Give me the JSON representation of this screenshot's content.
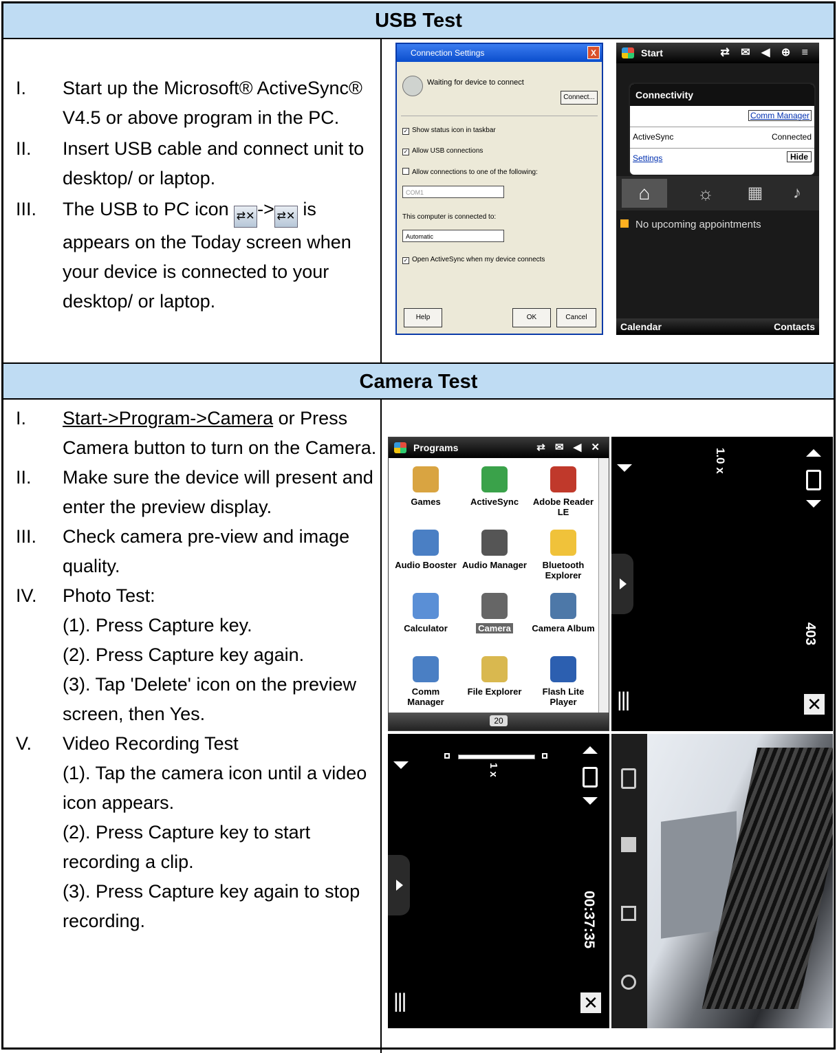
{
  "usb": {
    "heading": "USB Test",
    "steps": [
      {
        "num": "I.",
        "lines": [
          "Start up the Microsoft® ActiveSync® V4.5 or above program in the PC."
        ]
      },
      {
        "num": "II.",
        "lines": [
          "Insert USB cable and connect unit to desktop/ or laptop."
        ]
      },
      {
        "num": "III.",
        "pre": "The USB to PC icon",
        "mid": "->",
        "post": "is appears on the Today screen when your device is connected to your desktop/ or laptop."
      }
    ],
    "dialog": {
      "title": "Connection Settings",
      "close": "X",
      "status": "Waiting for device to connect",
      "connect_btn": "Connect...",
      "options": [
        "Show status icon in taskbar",
        "Allow USB connections",
        "Allow connections to one of the following:"
      ],
      "com_value": "COM1",
      "connected_to_label": "This computer is connected to:",
      "connected_to_value": "Automatic",
      "open_option": "Open ActiveSync when my device connects",
      "help_btn": "Help",
      "ok_btn": "OK",
      "cancel_btn": "Cancel"
    },
    "phone": {
      "start": "Start",
      "popup_title": "Connectivity",
      "comm_manager": "Comm Manager",
      "activesync": "ActiveSync",
      "activesync_status": "Connected",
      "settings": "Settings",
      "hide": "Hide",
      "appointments": "No upcoming appointments",
      "left_soft": "Calendar",
      "right_soft": "Contacts"
    }
  },
  "camera": {
    "heading": "Camera Test",
    "steps": [
      {
        "num": "I.",
        "link": "Start->Program->Camera",
        "rest": " or Press Camera button to turn on the Camera."
      },
      {
        "num": "II.",
        "text": "Make sure the device will present and enter the preview display."
      },
      {
        "num": "III.",
        "text": "Check camera pre-view and image quality."
      },
      {
        "num": "IV.",
        "text": "Photo Test:",
        "subs": [
          "(1). Press Capture key.",
          "(2). Press Capture key again.",
          "(3). Tap 'Delete' icon on the preview screen, then Yes."
        ]
      },
      {
        "num": "V.",
        "text": "Video Recording Test",
        "subs": [
          "(1). Tap the camera icon until a video icon appears.",
          "(2). Press Capture key to start recording a clip.",
          "(3). Press Capture key again to stop recording."
        ]
      }
    ],
    "programs": {
      "title": "Programs",
      "items": [
        "Games",
        "ActiveSync",
        "Adobe Reader LE",
        "Audio Booster",
        "Audio Manager",
        "Bluetooth Explorer",
        "Calculator",
        "Camera",
        "Camera Album",
        "Comm Manager",
        "File Explorer",
        "Flash Lite Player"
      ],
      "page": "20"
    },
    "photo_view": {
      "zoom": "1.0 x",
      "count": "403"
    },
    "video_view": {
      "zoom": "1 x",
      "time": "00:37:35"
    }
  }
}
